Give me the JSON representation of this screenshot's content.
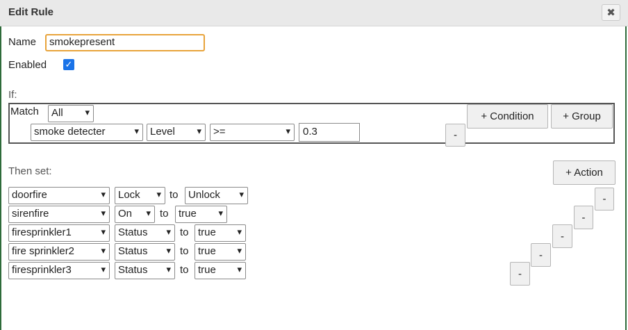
{
  "dialog": {
    "title": "Edit Rule",
    "close_glyph": "✖"
  },
  "name": {
    "label": "Name",
    "value": "smokepresent"
  },
  "enabled": {
    "label": "Enabled",
    "checked": true
  },
  "if_section": {
    "label": "If:",
    "match_label": "Match",
    "match_value": "All",
    "condition": {
      "device": "smoke detecter",
      "attribute": "Level",
      "operator": ">=",
      "value": "0.3"
    },
    "add_condition_label": "+ Condition",
    "add_group_label": "+ Group",
    "remove_label": "-"
  },
  "then_section": {
    "label": "Then set:",
    "add_action_label": "+ Action",
    "to_label": "to",
    "remove_label": "-",
    "actions": [
      {
        "device": "doorfire",
        "attribute": "Lock",
        "value": "Unlock"
      },
      {
        "device": "sirenfire",
        "attribute": "On",
        "value": "true"
      },
      {
        "device": "firesprinkler1",
        "attribute": "Status",
        "value": "true"
      },
      {
        "device": "fire sprinkler2",
        "attribute": "Status",
        "value": "true"
      },
      {
        "device": "firesprinkler3",
        "attribute": "Status",
        "value": "true"
      }
    ]
  },
  "colors": {
    "accent_border": "#e8a33a",
    "checkbox": "#1a73e8",
    "frame": "#2e6b3a"
  }
}
